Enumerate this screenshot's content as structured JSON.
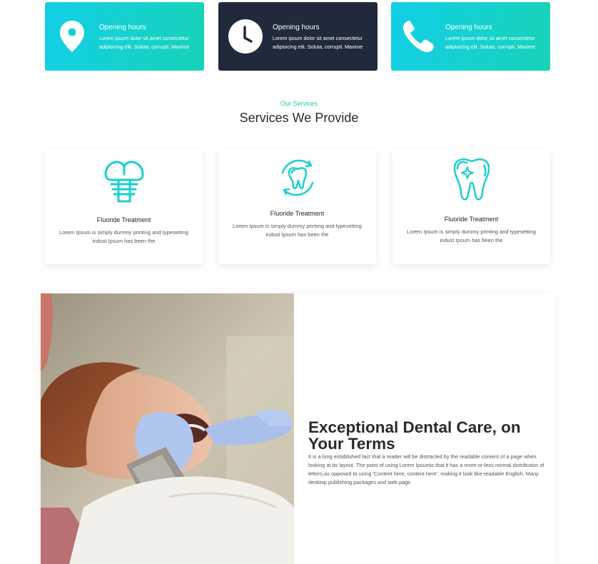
{
  "info_cards": [
    {
      "title": "Opening hours",
      "text": "Lorem ipsum dolor sit amet consectetur adipisicing elit. Soluta, corrupti. Maxime",
      "icon": "location-pin-icon"
    },
    {
      "title": "Opening hours",
      "text": "Lorem ipsum dolor sit amet consectetur adipisicing elit. Soluta, corrupti. Maxime",
      "icon": "clock-icon"
    },
    {
      "title": "Opening hours",
      "text": "Lorem ipsum dolor sit amet consectetur adipisicing elit. Soluta, corrupti. Maxime",
      "icon": "phone-icon"
    }
  ],
  "services": {
    "subtitle": "Our Services",
    "title": "Services We Provide",
    "items": [
      {
        "name": "Fluoride Treatment",
        "text": "Lorem Ipsum is simply dummy printing and typesetting indust Ipsum has been the",
        "icon": "dental-implant-icon"
      },
      {
        "name": "Fluoride Treatment",
        "text": "Lorem Ipsum is simply dummy printing and typesetting indust Ipsum has been the",
        "icon": "tooth-cycle-icon"
      },
      {
        "name": "Fluoride Treatment",
        "text": "Lorem Ipsum is simply dummy printing and typesetting indust Ipsum has been the",
        "icon": "sparkle-tooth-icon"
      }
    ]
  },
  "about": {
    "heading": "Exceptional Dental Care, on Your Terms",
    "text": "It is a long established fact that a reader will be distracted by the readable content of a page when looking at its layout. The point of using Lorem Ipsumis that it has a more-or-less normal distribution of letters,as opposed to using 'Content here, content here', making it look like readable English. Many desktop publishing packages and web page",
    "image": "dentist-patient-photo"
  },
  "colors": {
    "teal": "#18d3c0",
    "dark_card": "#212a3a",
    "accent_text": "#22c6a8"
  }
}
